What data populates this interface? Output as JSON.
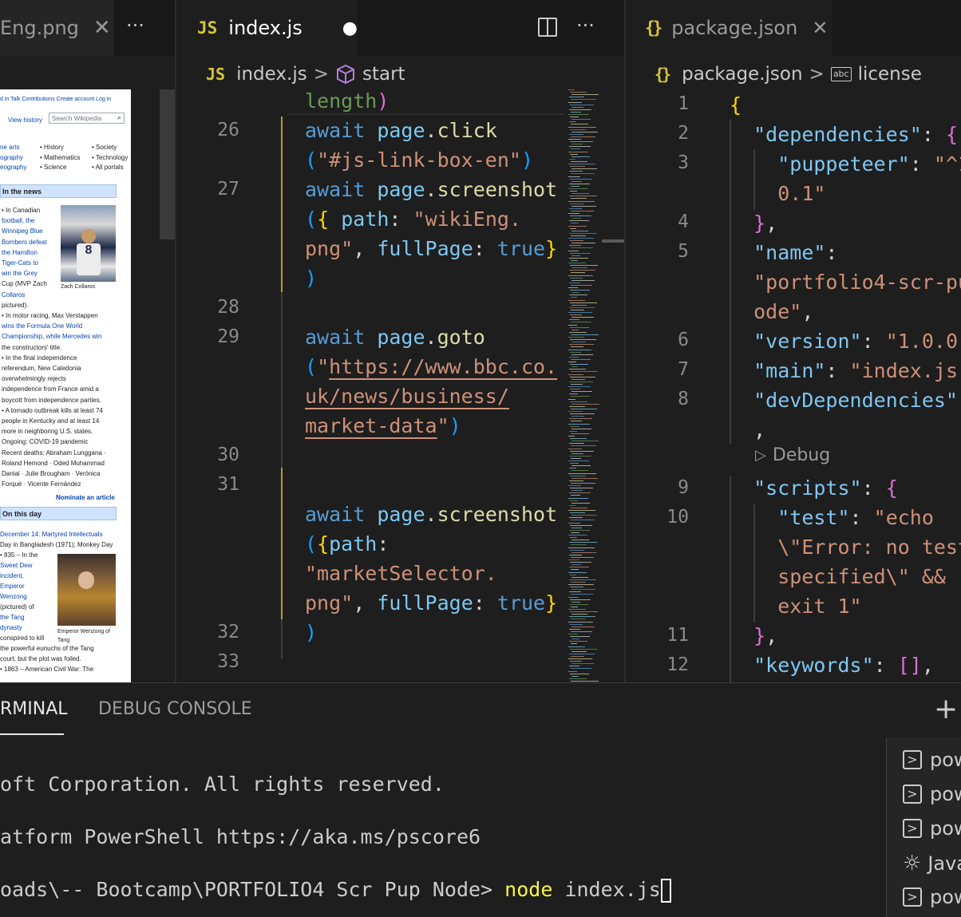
{
  "left_pane": {
    "tab_label": "Eng.png",
    "more_label": "···",
    "wiki": {
      "top_links": "d in   Talk   Contributions   Create account   Log in",
      "view_history": "View history",
      "search_placeholder": "Search Wikipedia",
      "portal_col1": [
        "ne arts",
        "ography",
        "eography"
      ],
      "portal_col2": [
        "• History",
        "• Mathematics",
        "• Science"
      ],
      "portal_col3": [
        "• Society",
        "• Technology",
        "• All portals"
      ],
      "news_heading": "In the news",
      "news_lines": [
        "• In Canadian",
        "football, the",
        "Winnipeg Blue",
        "Bombers defeat",
        "the Hamilton",
        "Tiger-Cats to",
        "win the Grey",
        "Cup (MVP Zach",
        "Collaros",
        "pictured).",
        "• In motor racing, Max Verstappen",
        "wins the Formula One World",
        "Championship, while Mercedes win",
        "the constructors' title.",
        "• In the final independence",
        "referendum, New Caledonia",
        "overwhelmingly rejects",
        "independence from France amid a",
        "boycott from independence parties.",
        "• A tornado outbreak kills at least 74",
        "people in Kentucky and at least 14",
        "more in neighboring U.S. states.",
        "Ongoing: COVID-19 pandemic",
        "Recent deaths: Abraham Lunggana ·",
        "Roland Hemond · Oded Muhammad",
        "Danial · Julie Brougham · Verónica",
        "Forqué · Vicente Fernández"
      ],
      "news_caption": "Zach Collaros",
      "nominate": "Nominate an article",
      "otd_heading": "On this day",
      "otd_lines": [
        "December 14: Martyred Intellectuals",
        "Day in Bangladesh (1971); Monkey Day",
        "• 835 – In the",
        "Sweet Dew",
        "incident,",
        "Emperor",
        "Wenzong",
        "(pictured) of",
        "the Tang",
        "dynasty",
        "conspired to kill",
        "the powerful eunuchs of the Tang",
        "court, but the plot was foiled.",
        "• 1863 – American Civil War: The"
      ],
      "otd_caption1": "Emperor Wenzong of",
      "otd_caption2": "Tang"
    }
  },
  "middle_pane": {
    "tab_icon": "JS",
    "tab_label": "index.js",
    "modified_dot": "●",
    "split_icon": "split-editor-icon",
    "more_label": "···",
    "breadcrumb": {
      "file_icon": "JS",
      "file": "index.js",
      "separator": ">",
      "symbol_icon": "cube-icon",
      "symbol": "start"
    },
    "line_numbers": [
      "26",
      "27",
      "28",
      "29",
      "30",
      "31",
      "32",
      "33"
    ]
  },
  "right_pane": {
    "tab_icon": "{}",
    "tab_label": "package.json",
    "close_label": "✕",
    "breadcrumb": {
      "file_icon": "{}",
      "file": "package.json",
      "separator": ">",
      "symbol_icon": "abc",
      "symbol": "license"
    },
    "line_numbers": [
      "1",
      "2",
      "3",
      "4",
      "5",
      "6",
      "7",
      "8",
      "9",
      "10",
      "11",
      "12"
    ],
    "debug_lens": "Debug"
  },
  "panel": {
    "tabs": [
      "RMINAL",
      "DEBUG CONSOLE"
    ],
    "add_label": "+",
    "terminal_lines": [
      "oft Corporation. All rights reserved.",
      "atform PowerShell https://aka.ms/pscore6",
      "oads\\-- Bootcamp\\PORTFOLIO4 Scr Pup Node>"
    ],
    "command_keyword": "node",
    "command_args": " index.js",
    "terminal_list": [
      {
        "icon": "terminal-icon",
        "label": "pow"
      },
      {
        "icon": "terminal-icon",
        "label": "pow"
      },
      {
        "icon": "terminal-icon",
        "label": "pow"
      },
      {
        "icon": "debug-icon",
        "label": "Java"
      },
      {
        "icon": "terminal-icon",
        "label": "pow"
      }
    ]
  }
}
